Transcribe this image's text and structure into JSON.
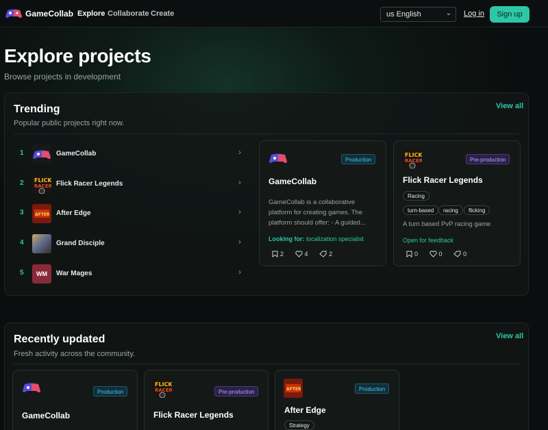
{
  "nav": {
    "brand": "GameCollab",
    "links": [
      "Explore",
      "Collaborate",
      "Create"
    ],
    "language": "us English",
    "login": "Log in",
    "signup": "Sign up"
  },
  "header": {
    "title": "Explore projects",
    "subtitle": "Browse projects in development"
  },
  "trending": {
    "title": "Trending",
    "subtitle": "Popular public projects right now.",
    "view_all": "View all",
    "list": [
      {
        "rank": "1",
        "name": "GameCollab",
        "thumb": "gamecollab-logo"
      },
      {
        "rank": "2",
        "name": "Flick Racer Legends",
        "thumb": "flick-racer-art"
      },
      {
        "rank": "3",
        "name": "After Edge",
        "thumb": "after-edge-art"
      },
      {
        "rank": "4",
        "name": "Grand Disciple",
        "thumb": "grand-disciple-art"
      },
      {
        "rank": "5",
        "name": "War Mages",
        "thumb": "WM"
      }
    ],
    "cards": [
      {
        "title": "GameCollab",
        "stage": "Production",
        "description": "GameCollab is a collaborative platform for creating games. The platform should offer: - A guided...",
        "looking_label": "Looking for:",
        "looking_value": "localization specialist",
        "saves": "2",
        "likes": "4",
        "tags_count": "2"
      },
      {
        "title": "Flick Racer Legends",
        "stage": "Pre-production",
        "genre": "Racing",
        "tags": [
          "turn-based",
          "racing",
          "flicking"
        ],
        "description": "A turn based PvP racing game",
        "status": "Open for feedback",
        "saves": "0",
        "likes": "0",
        "tags_count": "0"
      }
    ]
  },
  "recent": {
    "title": "Recently updated",
    "subtitle": "Fresh activity across the community.",
    "view_all": "View all",
    "cards": [
      {
        "title": "GameCollab",
        "stage": "Production"
      },
      {
        "title": "Flick Racer Legends",
        "stage": "Pre-production"
      },
      {
        "title": "After Edge",
        "stage": "Production",
        "genre": "Strategy"
      }
    ]
  },
  "colors": {
    "accent": "#2ec7a6",
    "production": "#4cc3e6",
    "preproduction": "#b9a5f5",
    "background": "#0b0e0e"
  }
}
